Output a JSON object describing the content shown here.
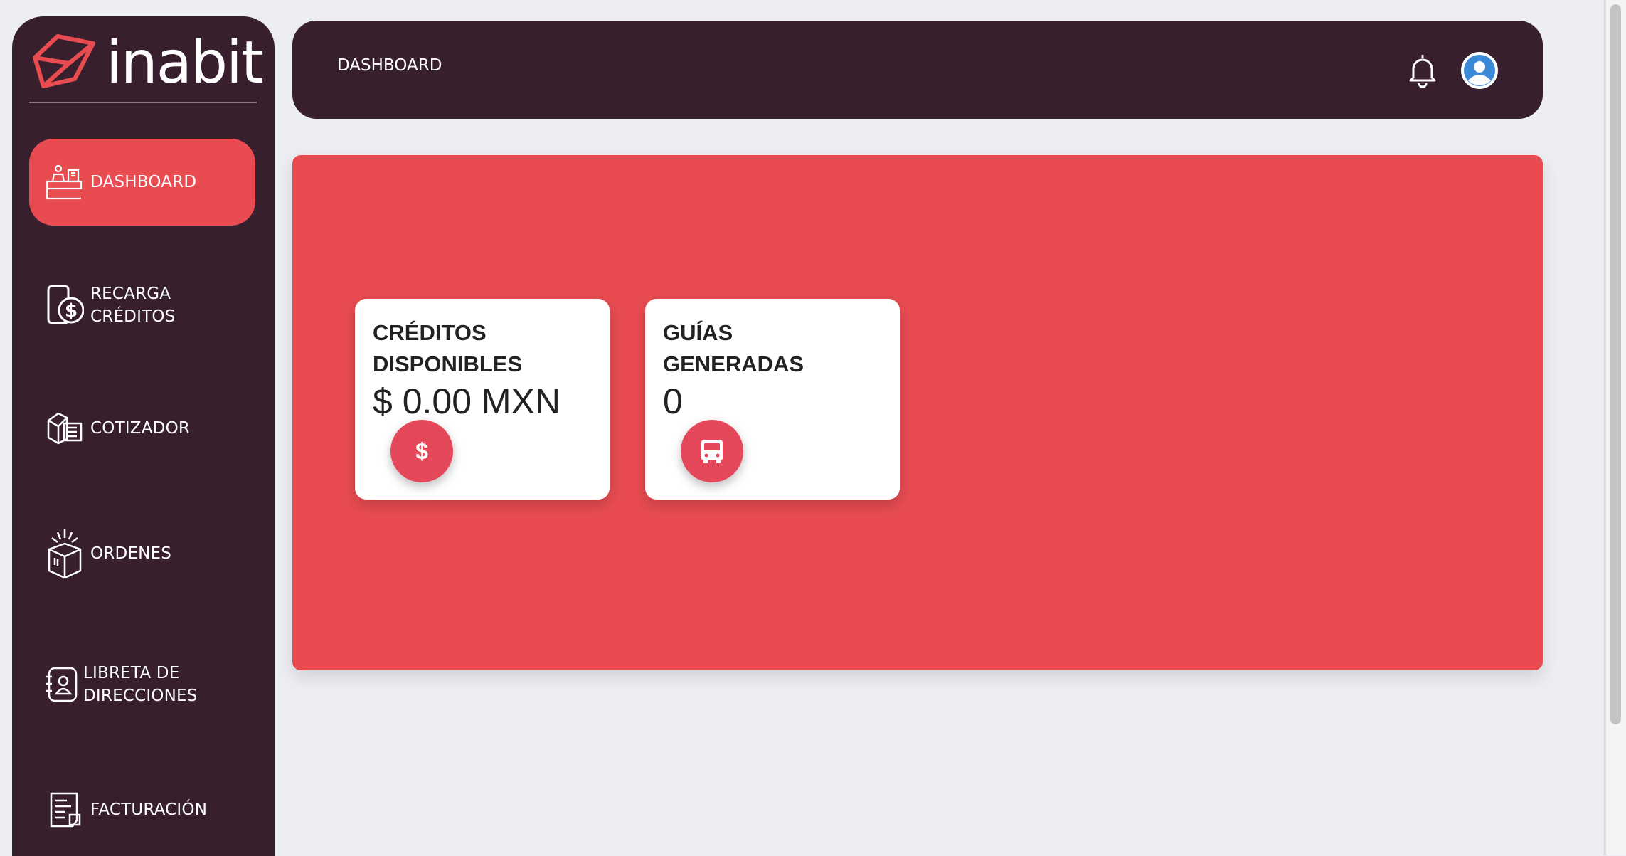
{
  "brand": {
    "name": "inabit",
    "logo_icon": "box-outline-logo"
  },
  "sidebar": {
    "items": [
      {
        "lines": [
          "DASHBOARD"
        ],
        "icon": "store-counter-icon",
        "active": true
      },
      {
        "lines": [
          "RECARGA",
          "CRÉDITOS"
        ],
        "icon": "phone-dollar-icon",
        "active": false
      },
      {
        "lines": [
          "COTIZADOR"
        ],
        "icon": "package-scale-icon",
        "active": false
      },
      {
        "lines": [
          "ORDENES"
        ],
        "icon": "open-box-icon",
        "active": false
      },
      {
        "lines": [
          "LIBRETA DE",
          "DIRECCIONES"
        ],
        "icon": "address-book-icon",
        "active": false
      },
      {
        "lines": [
          "FACTURACIÓN"
        ],
        "icon": "invoice-icon",
        "active": false
      }
    ]
  },
  "header": {
    "title": "DASHBOARD",
    "bell_icon": "bell-icon",
    "avatar_icon": "user-avatar-icon"
  },
  "cards": [
    {
      "title_lines": [
        "CRÉDITOS",
        "DISPONIBLES"
      ],
      "value": "$ 0.00 MXN",
      "badge_icon": "dollar-icon",
      "badge_text": "$"
    },
    {
      "title_lines": [
        "GUÍAS",
        "GENERADAS"
      ],
      "value": "0",
      "badge_icon": "bus-icon"
    }
  ],
  "colors": {
    "sidebar": "#381f2d",
    "accent": "#e84c51",
    "background": "#eceef3",
    "card": "#ffffff",
    "badge": "#e5485a"
  }
}
